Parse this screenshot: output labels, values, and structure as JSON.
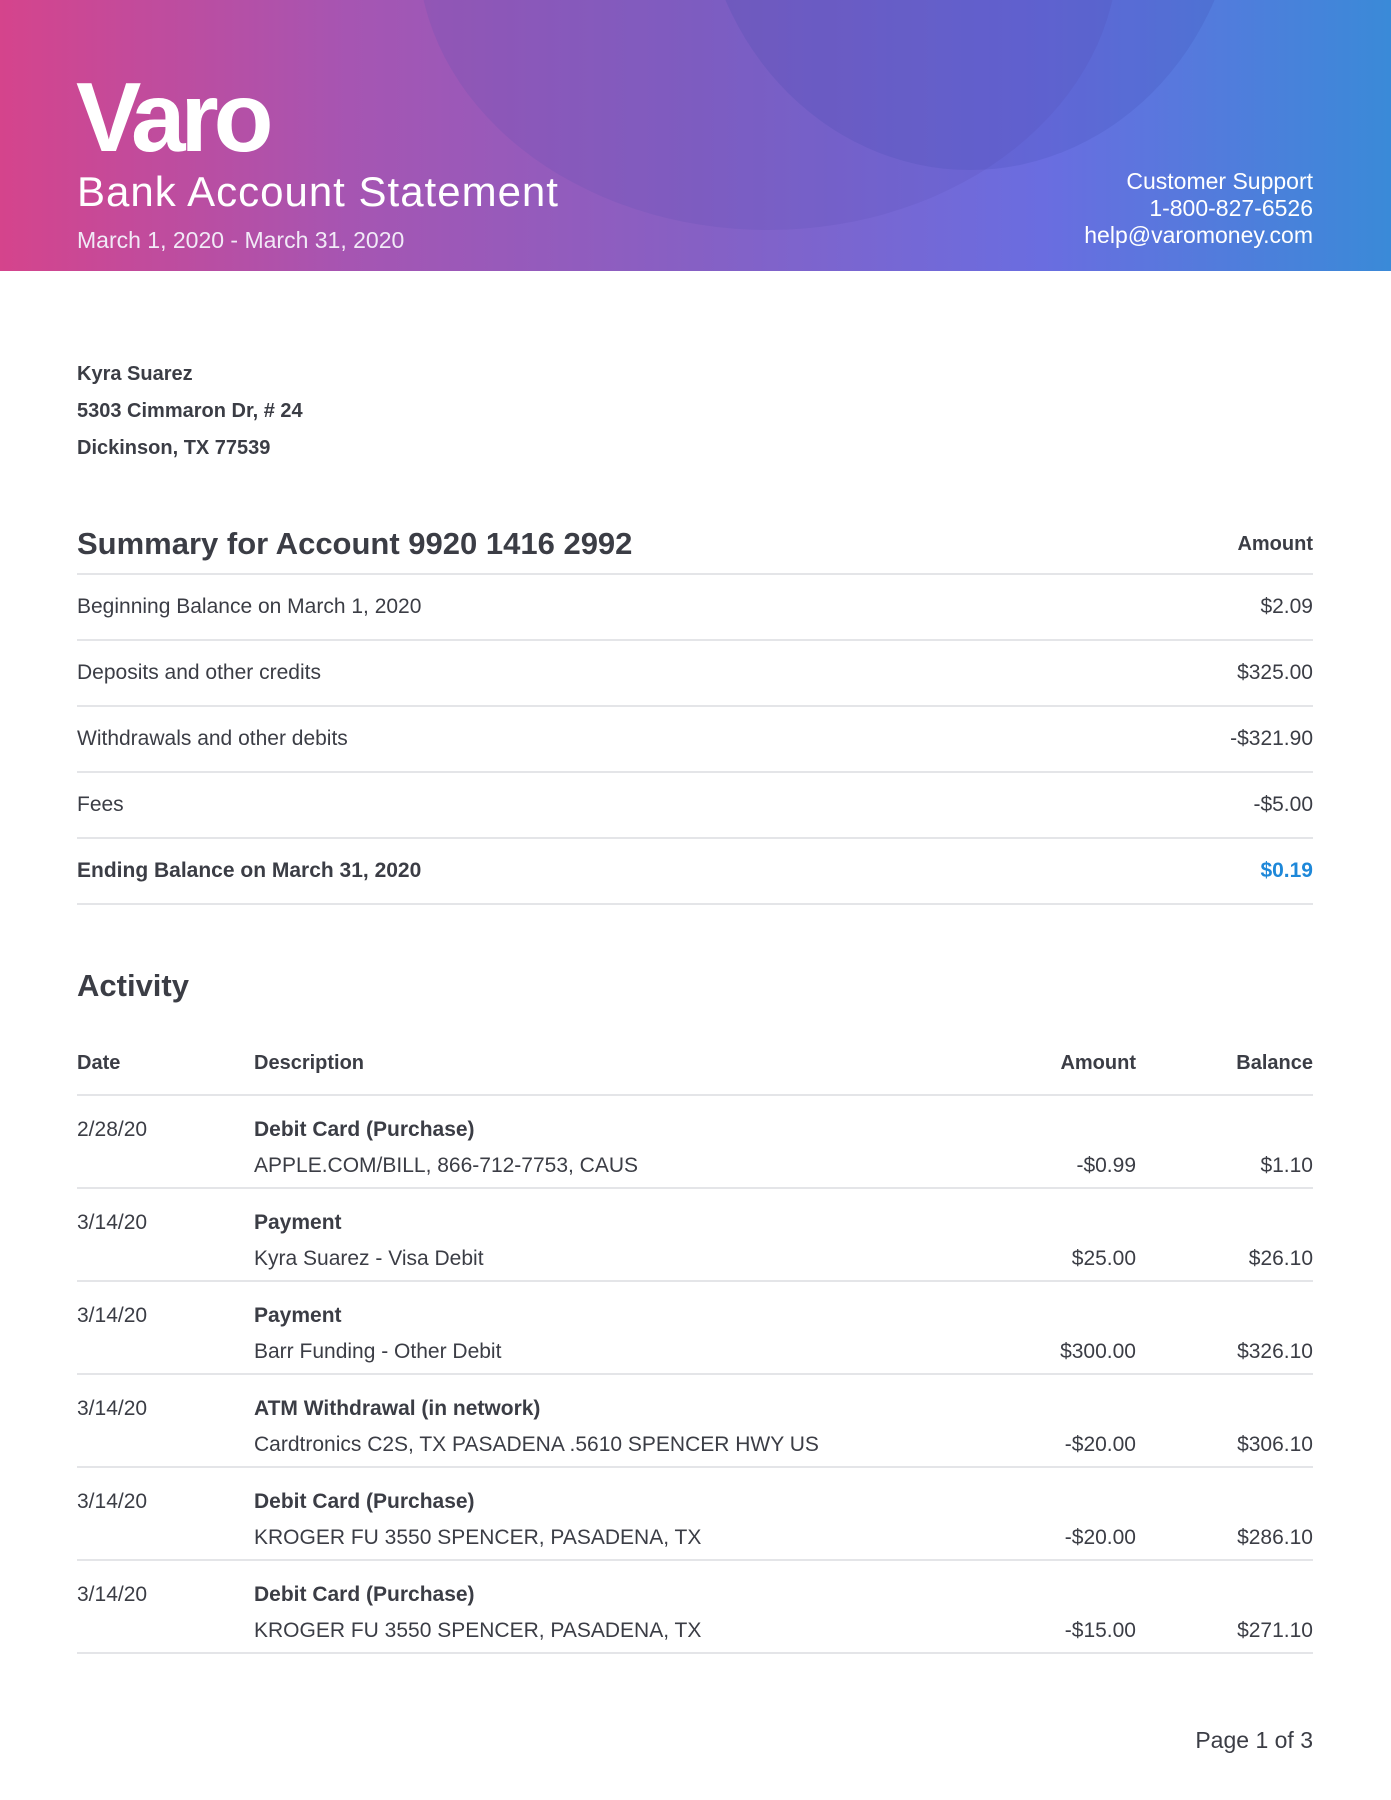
{
  "header": {
    "logo": "Varo",
    "title": "Bank Account Statement",
    "period": "March 1, 2020 - March 31, 2020",
    "support_label": "Customer Support",
    "support_phone": "1-800-827-6526",
    "support_email": "help@varomoney.com",
    "colors": {
      "gradient_start": "#d5448c",
      "gradient_end": "#3a8ad8"
    }
  },
  "customer": {
    "name": "Kyra Suarez",
    "street": "5303 Cimmaron Dr, # 24",
    "city": "Dickinson, TX 77539"
  },
  "summary": {
    "title": "Summary for Account 9920 1416 2992",
    "amount_header": "Amount",
    "rows": [
      {
        "label": "Beginning Balance on March 1, 2020",
        "amount": "$2.09"
      },
      {
        "label": "Deposits and other credits",
        "amount": "$325.00"
      },
      {
        "label": "Withdrawals and other debits",
        "amount": "-$321.90"
      },
      {
        "label": "Fees",
        "amount": "-$5.00"
      },
      {
        "label": "Ending Balance on March 31, 2020",
        "amount": "$0.19"
      }
    ],
    "accent_color": "#1e88d9"
  },
  "activity": {
    "title": "Activity",
    "headers": {
      "date": "Date",
      "description": "Description",
      "amount": "Amount",
      "balance": "Balance"
    },
    "rows": [
      {
        "date": "2/28/20",
        "type": "Debit Card (Purchase)",
        "merchant": "APPLE.COM/BILL, 866-712-7753, CAUS",
        "amount": "-$0.99",
        "balance": "$1.10"
      },
      {
        "date": "3/14/20",
        "type": "Payment",
        "merchant": "Kyra Suarez - Visa Debit",
        "amount": "$25.00",
        "balance": "$26.10"
      },
      {
        "date": "3/14/20",
        "type": "Payment",
        "merchant": "Barr Funding - Other Debit",
        "amount": "$300.00",
        "balance": "$326.10"
      },
      {
        "date": "3/14/20",
        "type": "ATM Withdrawal (in network)",
        "merchant": "Cardtronics C2S, TX PASADENA .5610 SPENCER HWY US",
        "amount": "-$20.00",
        "balance": "$306.10"
      },
      {
        "date": "3/14/20",
        "type": "Debit Card (Purchase)",
        "merchant": "KROGER FU 3550 SPENCER, PASADENA, TX",
        "amount": "-$20.00",
        "balance": "$286.10"
      },
      {
        "date": "3/14/20",
        "type": "Debit Card (Purchase)",
        "merchant": "KROGER FU 3550 SPENCER, PASADENA, TX",
        "amount": "-$15.00",
        "balance": "$271.10"
      }
    ]
  },
  "footer": {
    "page": "Page 1 of 3"
  }
}
